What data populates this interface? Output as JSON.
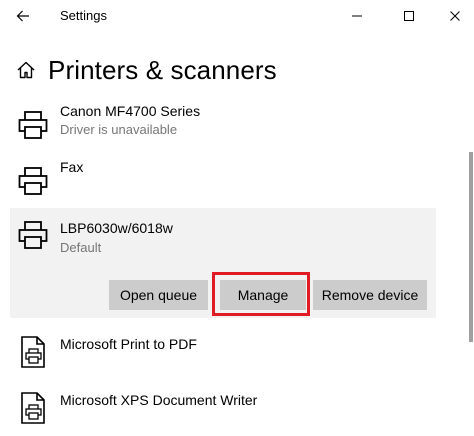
{
  "window": {
    "title": "Settings",
    "controls": {
      "back": "arrow-left-icon",
      "minimize": "minimize-icon",
      "maximize": "maximize-icon",
      "close": "close-icon"
    }
  },
  "header": {
    "icon": "home-icon",
    "title": "Printers & scanners"
  },
  "printers": [
    {
      "name": "Canon MF4700 Series",
      "status": "Driver is unavailable",
      "icon": "printer-icon"
    },
    {
      "name": "Fax",
      "status": "",
      "icon": "printer-icon"
    }
  ],
  "selected_printer": {
    "name": "LBP6030w/6018w",
    "status": "Default",
    "icon": "printer-icon",
    "actions": {
      "open_queue": "Open queue",
      "manage": "Manage",
      "remove": "Remove device"
    },
    "highlight_color": "#e01b24"
  },
  "documents": [
    {
      "name": "Microsoft Print to PDF",
      "icon": "document-printer-icon"
    },
    {
      "name": "Microsoft XPS Document Writer",
      "icon": "document-printer-icon"
    }
  ],
  "colors": {
    "selected_background": "#f2f2f2",
    "button_background": "#cccccc",
    "secondary_text": "#767676"
  }
}
